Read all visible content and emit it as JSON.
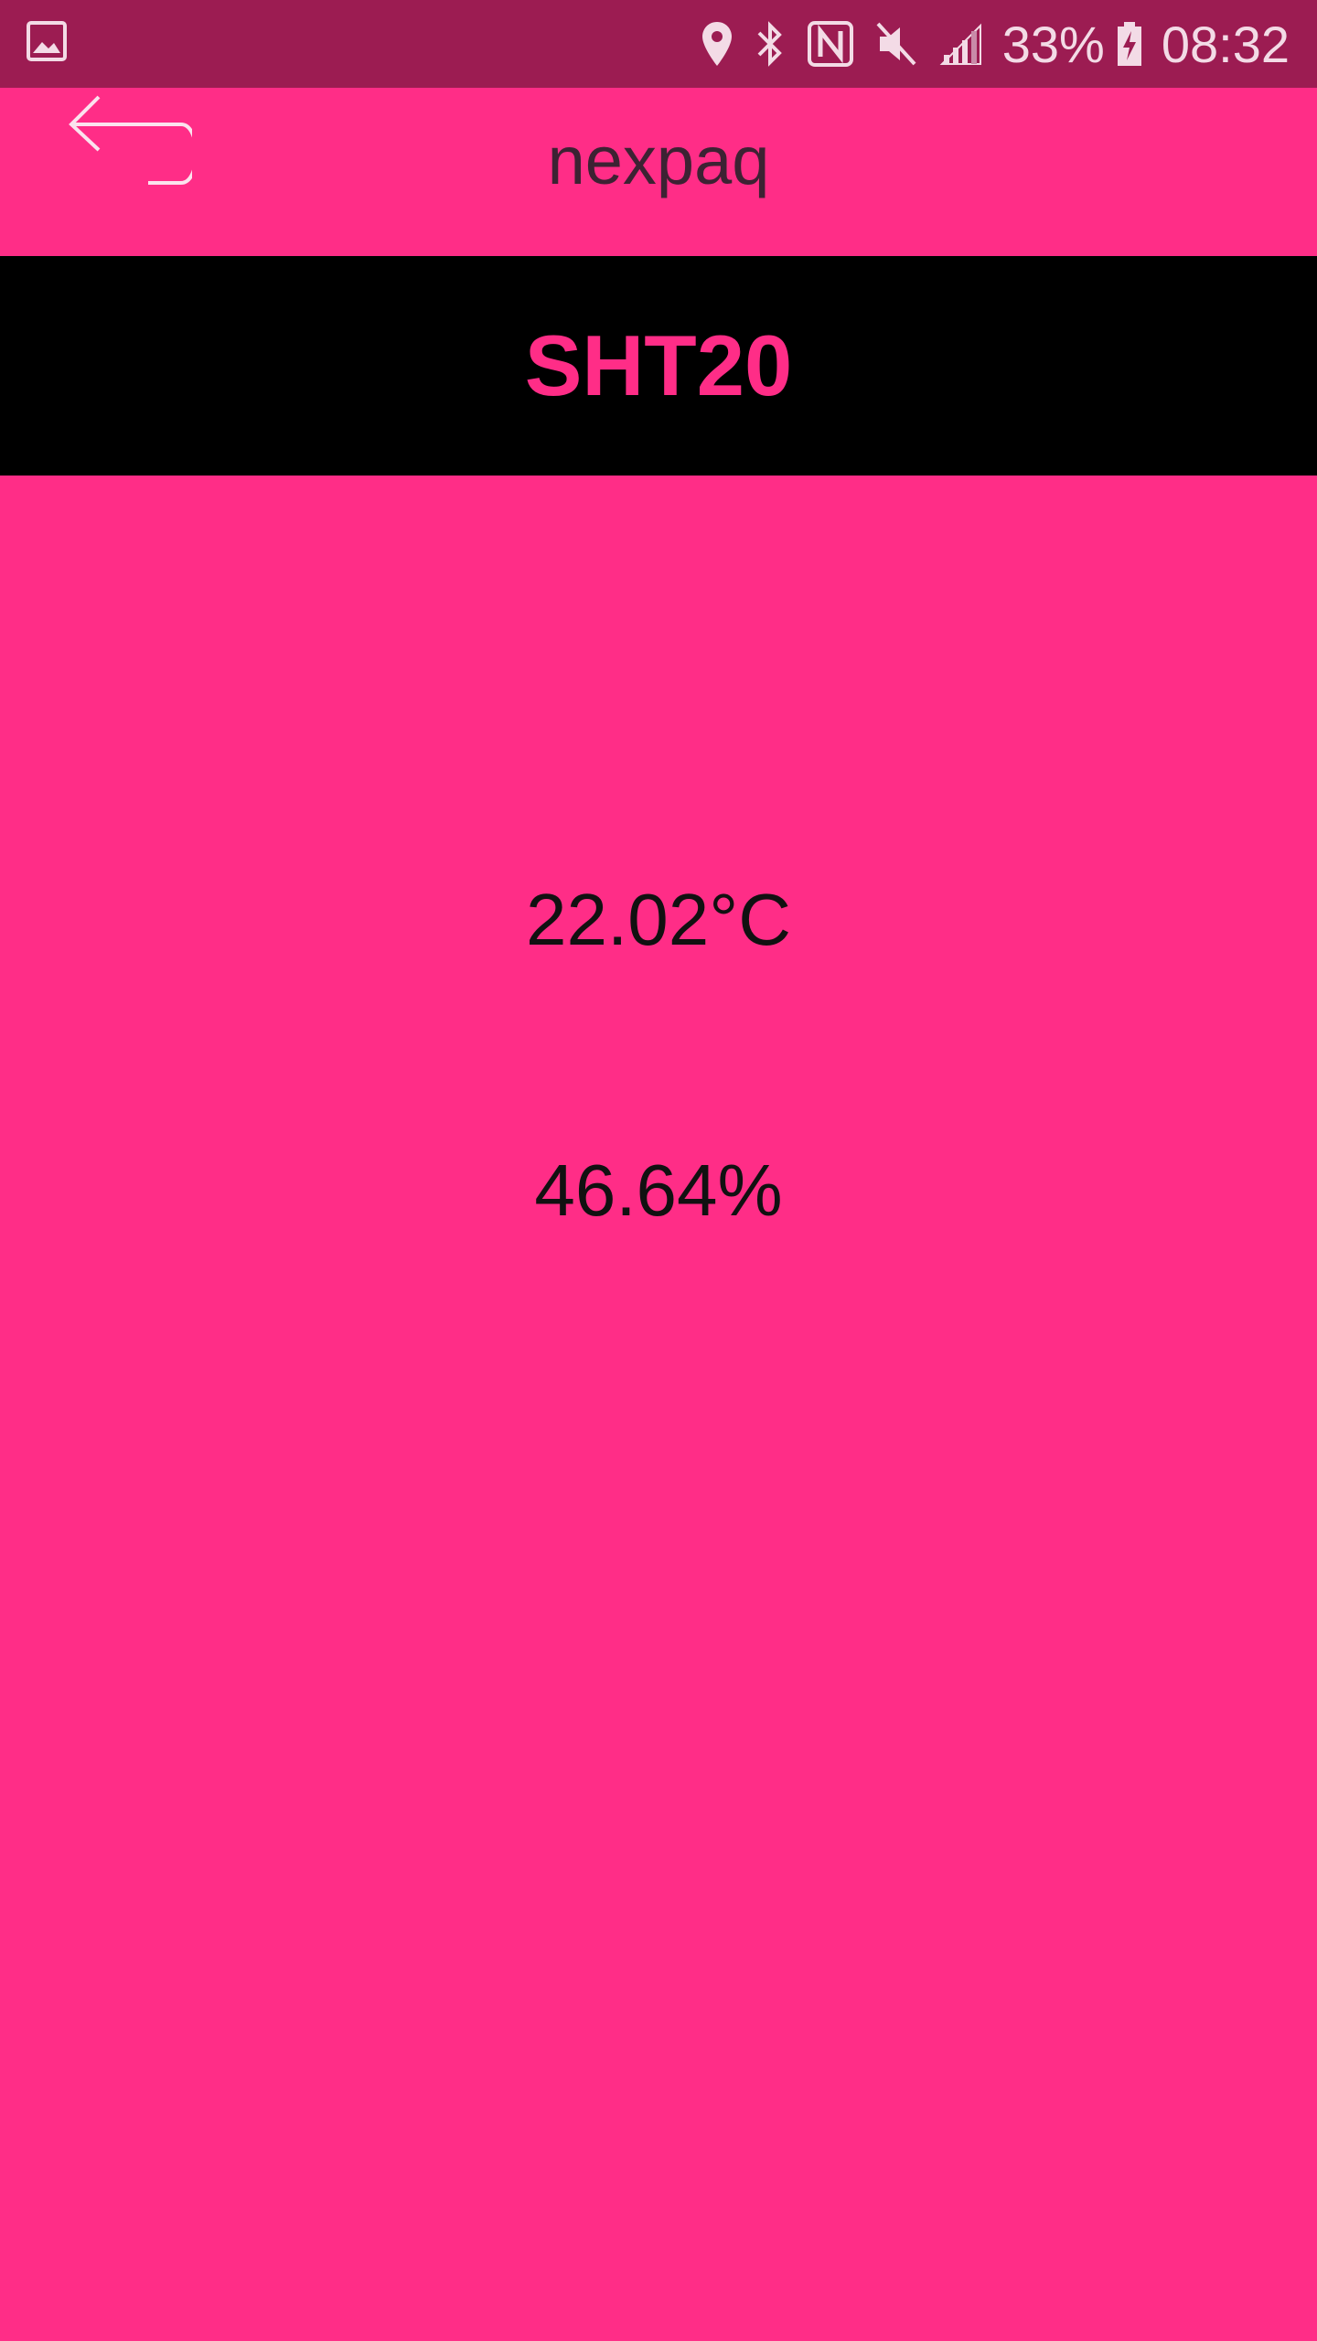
{
  "status_bar": {
    "notification_icon": "image-icon",
    "icons": [
      "location-icon",
      "bluetooth-icon",
      "nfc-icon",
      "mute-icon",
      "signal-icon"
    ],
    "battery_percent": "33%",
    "battery_icon": "battery-charging-icon",
    "time": "08:32"
  },
  "app_bar": {
    "back_icon": "undo-arrow-icon",
    "title": "nexpaq"
  },
  "sensor": {
    "name": "SHT20"
  },
  "readings": {
    "temperature": "22.02°C",
    "humidity": "46.64%"
  },
  "colors": {
    "background": "#ff2d87",
    "status_bar": "#9c1c52",
    "header_band": "#000000",
    "sensor_name": "#ff2d87"
  }
}
